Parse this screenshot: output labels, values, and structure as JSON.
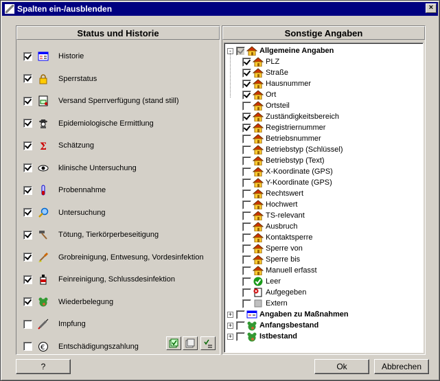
{
  "window": {
    "title": "Spalten ein-/ausblenden",
    "close_label": "×"
  },
  "left_panel": {
    "header": "Status und Historie",
    "items": [
      {
        "label": "Historie",
        "checked": true,
        "icon": "history-icon"
      },
      {
        "label": "Sperrstatus",
        "checked": true,
        "icon": "lock-icon"
      },
      {
        "label": "Versand Sperrverfügung (stand still)",
        "checked": true,
        "icon": "mail-doc-icon"
      },
      {
        "label": "Epidemiologische Ermittlung",
        "checked": true,
        "icon": "detective-icon"
      },
      {
        "label": "Schätzung",
        "checked": true,
        "icon": "sigma-icon"
      },
      {
        "label": "klinische Untersuchung",
        "checked": true,
        "icon": "eye-icon"
      },
      {
        "label": "Probennahme",
        "checked": true,
        "icon": "sample-tube-icon"
      },
      {
        "label": "Untersuchung",
        "checked": true,
        "icon": "magnifier-icon"
      },
      {
        "label": "Tötung, Tierkörperbeseitigung",
        "checked": true,
        "icon": "hammer-icon"
      },
      {
        "label": "Grobreinigung, Entwesung, Vordesinfektion",
        "checked": true,
        "icon": "brush-icon"
      },
      {
        "label": "Feinreinigung, Schlussdesinfektion",
        "checked": true,
        "icon": "spray-icon"
      },
      {
        "label": "Wiederbelegung",
        "checked": true,
        "icon": "animal-head-icon"
      },
      {
        "label": "Impfung",
        "checked": false,
        "icon": "syringe-icon"
      },
      {
        "label": "Entschädigungszahlung",
        "checked": false,
        "icon": "euro-icon"
      }
    ]
  },
  "right_panel": {
    "header": "Sonstige Angaben",
    "root": {
      "label": "Allgemeine Angaben",
      "checked": "partial",
      "expanded": true
    },
    "children": [
      {
        "label": "PLZ",
        "checked": true,
        "icon": "house-icon"
      },
      {
        "label": "Straße",
        "checked": true,
        "icon": "house-icon"
      },
      {
        "label": "Hausnummer",
        "checked": true,
        "icon": "house-icon"
      },
      {
        "label": "Ort",
        "checked": true,
        "icon": "house-icon"
      },
      {
        "label": "Ortsteil",
        "checked": false,
        "icon": "house-icon"
      },
      {
        "label": "Zuständigkeitsbereich",
        "checked": true,
        "icon": "house-icon"
      },
      {
        "label": "Registriernummer",
        "checked": true,
        "icon": "house-icon"
      },
      {
        "label": "Betriebsnummer",
        "checked": false,
        "icon": "house-icon"
      },
      {
        "label": "Betriebstyp (Schlüssel)",
        "checked": false,
        "icon": "house-icon"
      },
      {
        "label": "Betriebstyp (Text)",
        "checked": false,
        "icon": "house-icon"
      },
      {
        "label": "X-Koordinate (GPS)",
        "checked": false,
        "icon": "house-icon"
      },
      {
        "label": "Y-Koordinate (GPS)",
        "checked": false,
        "icon": "house-icon"
      },
      {
        "label": "Rechtswert",
        "checked": false,
        "icon": "house-icon"
      },
      {
        "label": "Hochwert",
        "checked": false,
        "icon": "house-icon"
      },
      {
        "label": "TS-relevant",
        "checked": false,
        "icon": "house-icon"
      },
      {
        "label": "Ausbruch",
        "checked": false,
        "icon": "house-icon"
      },
      {
        "label": "Kontaktsperre",
        "checked": false,
        "icon": "house-icon"
      },
      {
        "label": "Sperre von",
        "checked": false,
        "icon": "house-icon"
      },
      {
        "label": "Sperre bis",
        "checked": false,
        "icon": "house-icon"
      },
      {
        "label": "Manuell erfasst",
        "checked": false,
        "icon": "house-icon"
      },
      {
        "label": "Leer",
        "checked": false,
        "icon": "green-check-icon"
      },
      {
        "label": "Aufgegeben",
        "checked": false,
        "icon": "deleted-icon"
      },
      {
        "label": "Extern",
        "checked": false,
        "icon": "gray-square-icon"
      }
    ],
    "groups": [
      {
        "label": "Angaben zu Maßnahmen",
        "icon": "measures-icon"
      },
      {
        "label": "Anfangsbestand",
        "icon": "animal-head-icon"
      },
      {
        "label": "Istbestand",
        "icon": "animal-head-icon"
      }
    ]
  },
  "footer": {
    "help_label": "?",
    "ok_label": "Ok",
    "cancel_label": "Abbrechen"
  }
}
